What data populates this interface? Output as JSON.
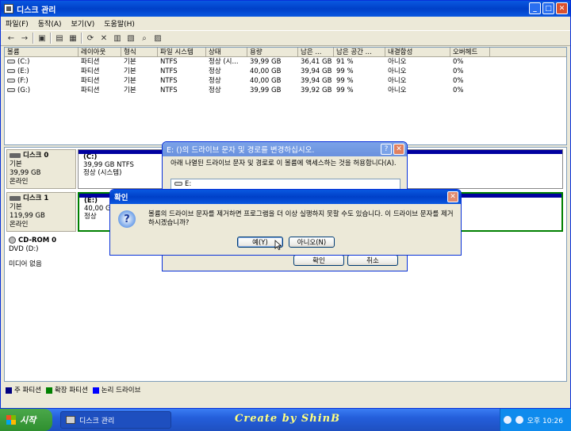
{
  "window": {
    "title": "디스크 관리"
  },
  "menu": [
    "파일(F)",
    "동작(A)",
    "보기(V)",
    "도움말(H)"
  ],
  "volume_list": {
    "columns": [
      "볼륨",
      "레이아웃",
      "형식",
      "파일 시스템",
      "상태",
      "용량",
      "남은 ...",
      "남은 공간 ...",
      "내결함성",
      "오버헤드"
    ],
    "rows": [
      [
        "(C:)",
        "파티션",
        "기본",
        "NTFS",
        "정상 (시...",
        "39,99 GB",
        "36,41 GB",
        "91 %",
        "아니오",
        "0%"
      ],
      [
        "(E:)",
        "파티션",
        "기본",
        "NTFS",
        "정상",
        "40,00 GB",
        "39,94 GB",
        "99 %",
        "아니오",
        "0%"
      ],
      [
        "(F:)",
        "파티션",
        "기본",
        "NTFS",
        "정상",
        "40,00 GB",
        "39,94 GB",
        "99 %",
        "아니오",
        "0%"
      ],
      [
        "(G:)",
        "파티션",
        "기본",
        "NTFS",
        "정상",
        "39,99 GB",
        "39,92 GB",
        "99 %",
        "아니오",
        "0%"
      ]
    ]
  },
  "disks": {
    "disk0": {
      "name": "디스크 0",
      "type": "기본",
      "size": "39,99 GB",
      "status": "온라인",
      "partition": {
        "name": "(C:)",
        "size": "39,99 GB NTFS",
        "status": "정상 (시스템)"
      }
    },
    "disk1": {
      "name": "디스크 1",
      "type": "기본",
      "size": "119,99 GB",
      "status": "온라인",
      "partition": {
        "name": "(E:)",
        "size": "40,00 GB",
        "status": "정상"
      }
    },
    "cdrom0": {
      "name": "CD-ROM 0",
      "type": "DVD (D:)",
      "status": "미디어 없음"
    }
  },
  "legend": [
    {
      "label": "주 파티션",
      "color": "#000080"
    },
    {
      "label": "확장 파티션",
      "color": "#008000"
    },
    {
      "label": "논리 드라이브",
      "color": "#0000ff"
    }
  ],
  "change_dialog": {
    "title": "E: ()의 드라이브 문자 및 경로를 변경하십시오.",
    "description": "아래 나열된 드라이브 문자 및 경로로 이 볼륨에 액세스하는 것을 허용합니다(A).",
    "list_item": "E:",
    "help": "?",
    "ok": "확인",
    "cancel": "취소"
  },
  "confirm_dialog": {
    "title": "확인",
    "message": "볼륨의 드라이브 문자를 제거하면 프로그램을 더 이상 실행하지 못할 수도 있습니다. 이 드라이브 문자를 제거하시겠습니까?",
    "yes": "예(Y)",
    "no": "아니오(N)"
  },
  "taskbar": {
    "start": "시작",
    "task": "디스크 관리",
    "watermark": "Create by ShinB",
    "clock": "오후 10:26"
  }
}
